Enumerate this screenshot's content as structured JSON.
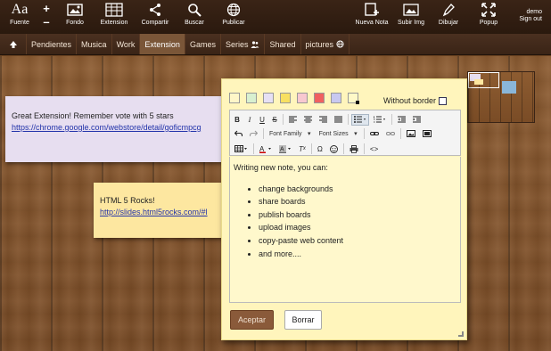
{
  "toolbar": {
    "fuente_label": "Fuente",
    "fuente_glyph": "Aa",
    "plus": "+",
    "minus": "–",
    "fondo_label": "Fondo",
    "extension_label": "Extension",
    "compartir_label": "Compartir",
    "buscar_label": "Buscar",
    "publicar_label": "Publicar",
    "nueva_nota_label": "Nueva Nota",
    "subir_img_label": "Subir Img",
    "dibujar_label": "Dibujar",
    "popup_label": "Popup",
    "user_name": "demo",
    "sign_out": "Sign out"
  },
  "tabs": [
    {
      "label": "Pendientes"
    },
    {
      "label": "Musica"
    },
    {
      "label": "Work"
    },
    {
      "label": "Extension",
      "active": true
    },
    {
      "label": "Games"
    },
    {
      "label": "Series",
      "icon": "people-icon"
    },
    {
      "label": "Shared"
    },
    {
      "label": "pictures",
      "icon": "globe-icon"
    }
  ],
  "notes": {
    "purple": {
      "text": "Great Extension! Remember vote with 5 stars",
      "link": "https://chrome.google.com/webstore/detail/goficmpcg"
    },
    "yellow": {
      "text": "HTML 5 Rocks!",
      "link": "http://slides.html5rocks.com/#l"
    }
  },
  "editor": {
    "swatch_colors": [
      "#fff6c8",
      "#d8f0d0",
      "#e6e0f4",
      "#f8e060",
      "#f8c8d0",
      "#f06060",
      "#c8c8f0",
      "#fff9c8"
    ],
    "without_border_label": "Without border",
    "font_family_label": "Font Family",
    "font_sizes_label": "Font Sizes",
    "intro": "Writing new note, you can:",
    "bullets": [
      "change backgrounds",
      "share boards",
      "publish boards",
      "upload images",
      "copy-paste web content",
      "and more...."
    ],
    "accept_label": "Aceptar",
    "delete_label": "Borrar"
  },
  "colors": {
    "topbar": "#2f1c10",
    "active_tab": "#7a5638",
    "wood": "#8d5c31",
    "accept_button": "#8a5a3a"
  }
}
